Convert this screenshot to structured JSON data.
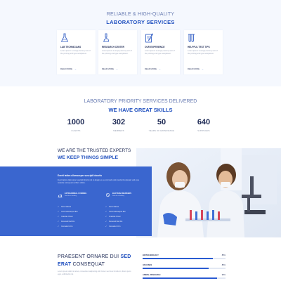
{
  "services": {
    "subtitle": "RELIABLE & HIGH-QUALITY",
    "title": "LABORATORY SERVICES",
    "cards": [
      {
        "icon": "flask-icon",
        "title": "LAB TECHNICIANS",
        "desc": "Lorem ipsum is simply dummy text of the printing and type sampletext.",
        "link": "READ MORE"
      },
      {
        "icon": "microscope-icon",
        "title": "RESEARCH CENTER",
        "desc": "Lorem ipsum is simply dummy text of the printing and type sampletext.",
        "link": "READ MORE"
      },
      {
        "icon": "pen-clipboard-icon",
        "title": "OUR EXPERIENCE",
        "desc": "Lorem ipsum is simply dummy text of the printing and type sampletext.",
        "link": "READ MORE"
      },
      {
        "icon": "test-tubes-icon",
        "title": "HELPFUL TEST TIPS",
        "desc": "Lorem ipsum is simply dummy text of the printing and type sampletext.",
        "link": "READ MORE"
      }
    ]
  },
  "stats": {
    "subtitle": "LABORATORY PRIORITY SERVICES DELIVERED",
    "title": "WE HAVE GREAT SKILLS",
    "items": [
      {
        "number": "1000",
        "label": "CLIENTS"
      },
      {
        "number": "302",
        "label": "MEMBERS"
      },
      {
        "number": "50",
        "label": "YEARS OF EXPERIENCE"
      },
      {
        "number": "640",
        "label": "SUPPLIERS"
      }
    ]
  },
  "trusted": {
    "title1": "WE ARE THE TRUSTED EXPERTS",
    "title2": "WE KEEP THINGS SIMPLE",
    "box_heading": "Everti tation ullamcorper suscipit lobortis",
    "box_desc": "Everti tation ullamcorper suscipit lobortis nisl ut aliquip ex ea commodo duis hendrerit vulputate velit esse molestie consequat vel illum dolore.",
    "features": [
      {
        "icon": "chart-icon",
        "title": "EXTRAORINAL FUNDING",
        "sub": "Sed do ut leading"
      },
      {
        "icon": "bacteria-icon",
        "title": "BACTERIA MARKERS",
        "sub": "Sed do ut leading"
      }
    ],
    "list_left": [
      "Nunc Massa",
      "Commodosequat Est",
      "Gravitas Omen",
      "Dunesult Nah Fis",
      "Convalis Id Un"
    ],
    "list_right": [
      "Nunc Massa",
      "Commodosequat Est",
      "Gravitas Omen",
      "Dunesult Nah Fis",
      "Convalis Id Un"
    ]
  },
  "praesent": {
    "title_line1": "PRAESENT ORNARE DUI",
    "title_bold1": "SED",
    "title_line2_bold": "ERAT",
    "title_line2": "CONSEQUAT",
    "desc": "Lorem ipsum dolor sit amet, consectetur adipiscing elit. Donec sed nunc tincidunt, dictum justo eget, sollicitudin nisi.",
    "bars": [
      {
        "label": "BIOTECHNOLOGY",
        "value": 85,
        "display": "85%"
      },
      {
        "label": "VACCINES",
        "value": 80,
        "display": "80%"
      },
      {
        "label": "ANIMAL RESEARCH",
        "value": 90,
        "display": "90%"
      }
    ]
  },
  "colors": {
    "accent": "#1f4fbf",
    "box": "#3a66cf",
    "bg_light": "#f5f8fe"
  }
}
